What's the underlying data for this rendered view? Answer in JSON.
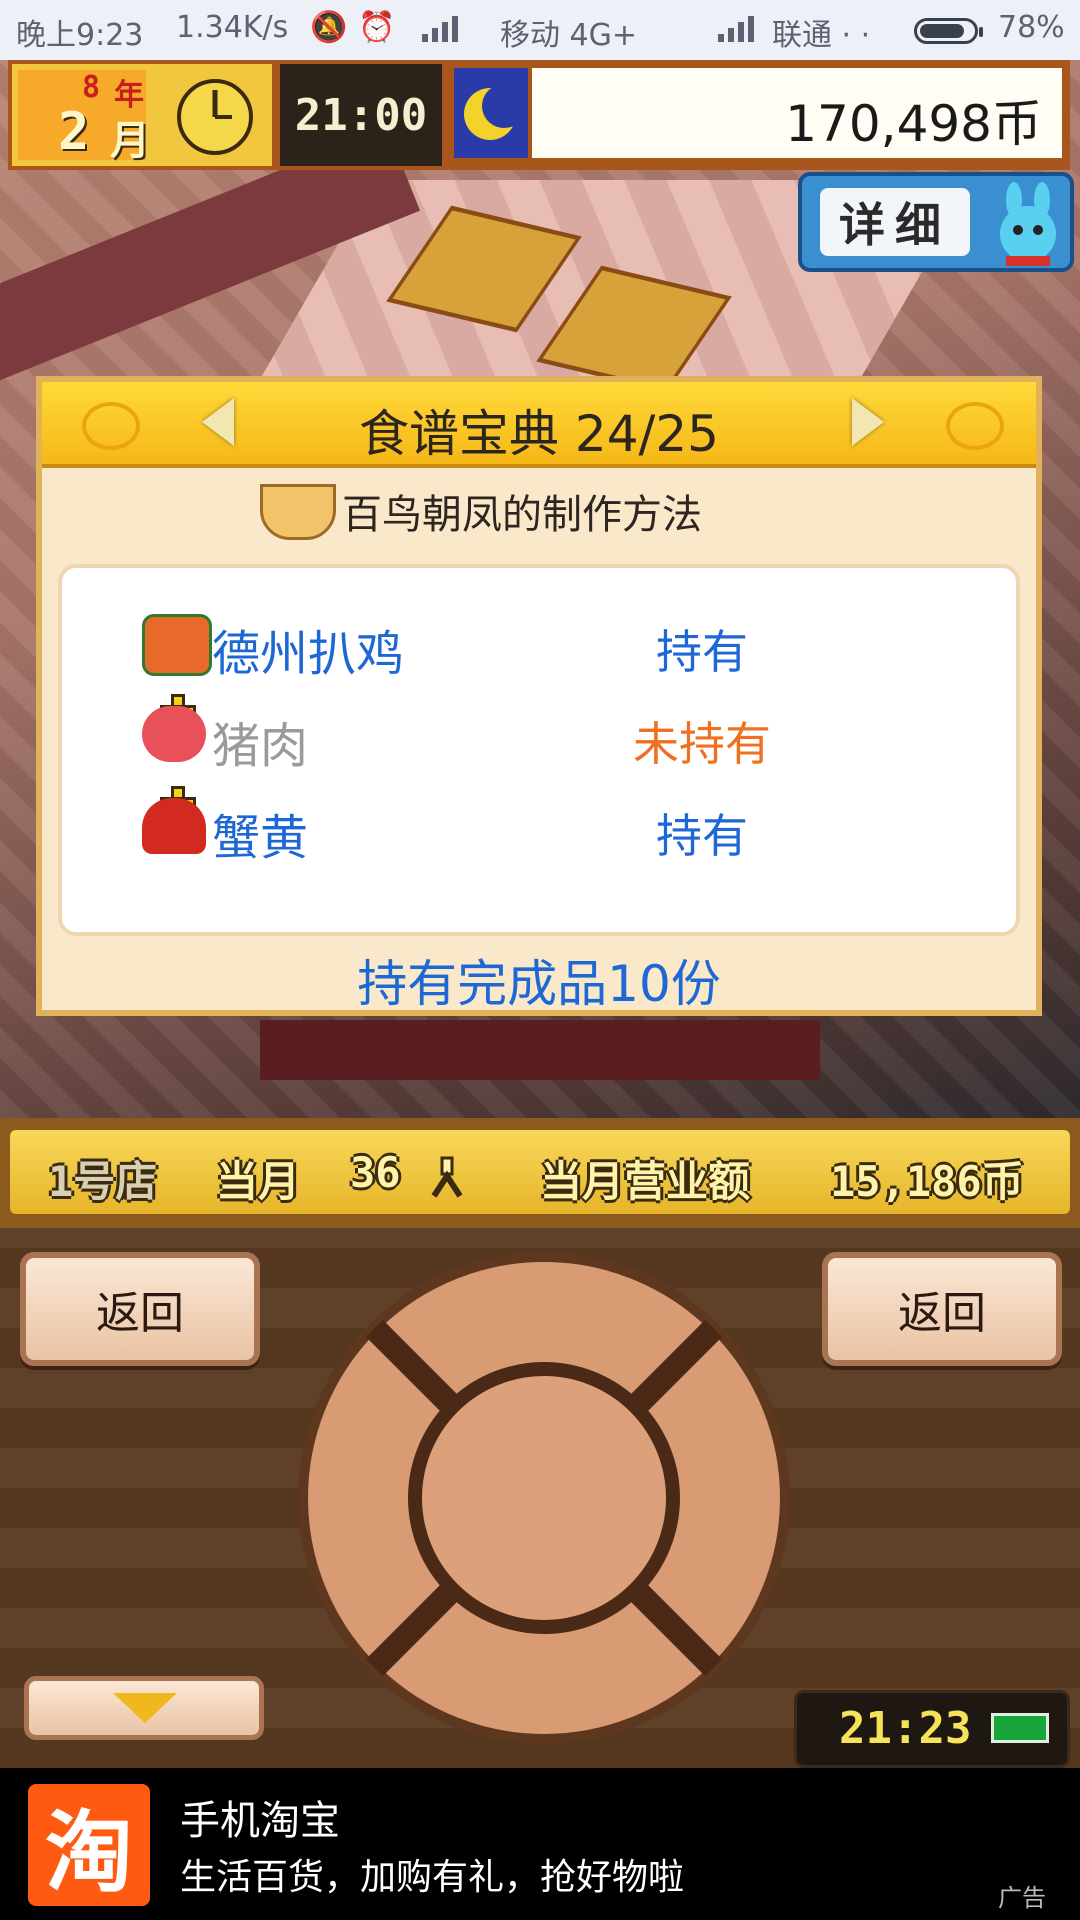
{
  "status_bar": {
    "time": "晚上9:23",
    "net_speed": "1.34K/s",
    "carrier1": "移动 4G+",
    "carrier2": "联通 · ·",
    "battery": "78%"
  },
  "hud": {
    "year_num": "8",
    "year_label": "年",
    "month_num": "2",
    "month_label": "月",
    "game_time": "21:00",
    "money": "170,498币",
    "detail_label": "详细"
  },
  "recipe_panel": {
    "title": "食谱宝典 24/25",
    "recipe_name": "百鸟朝凤的制作方法",
    "ingredients": [
      {
        "name": "德州扒鸡",
        "status": "持有",
        "name_color": "#1e68d6",
        "status_color": "#1e68d6"
      },
      {
        "name": "猪肉",
        "status": "未持有",
        "name_color": "#9a9a9a",
        "status_color": "#f07022"
      },
      {
        "name": "蟹黄",
        "status": "持有",
        "name_color": "#1e68d6",
        "status_color": "#1e68d6"
      }
    ],
    "owned_count": "持有完成品10份"
  },
  "shop_bar": {
    "store": "1号店",
    "month_label": "当月",
    "visitors": "36",
    "revenue_label": "当月营业额",
    "revenue": "15,186币"
  },
  "controls": {
    "left_button": "返回",
    "right_button": "返回",
    "clock": "21:23"
  },
  "ad": {
    "logo_char": "淘",
    "title": "手机淘宝",
    "desc": "生活百货，加购有礼，抢好物啦",
    "tag": "广告"
  }
}
